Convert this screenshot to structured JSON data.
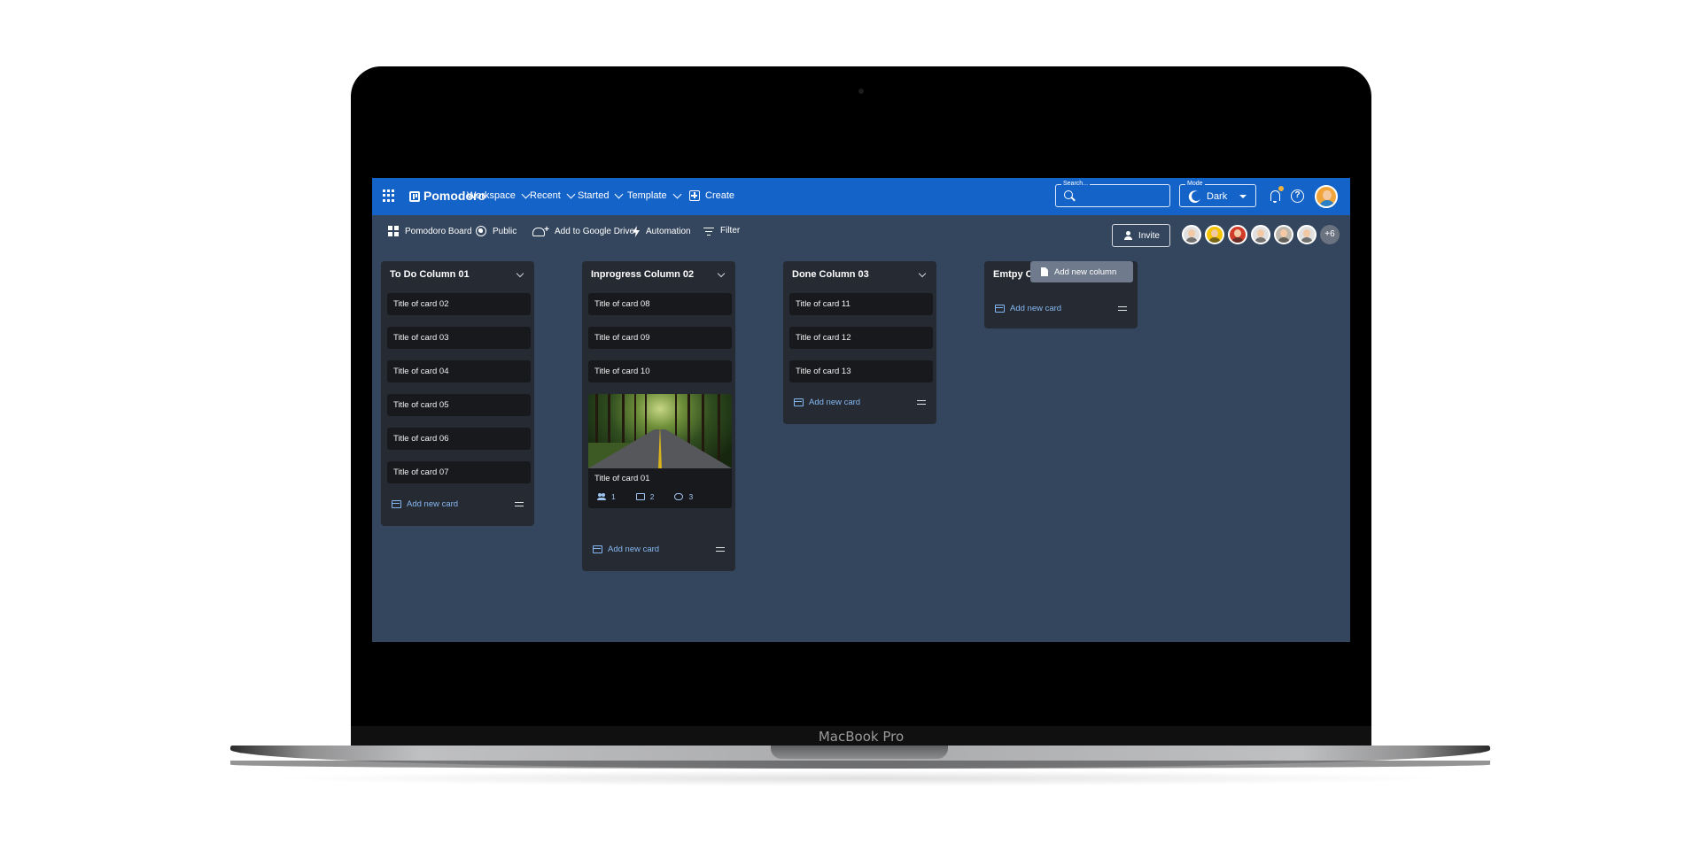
{
  "device": {
    "label": "MacBook Pro"
  },
  "appbar": {
    "brand": "Pomodoro",
    "nav": [
      {
        "label": "Workspace"
      },
      {
        "label": "Recent"
      },
      {
        "label": "Started"
      },
      {
        "label": "Template"
      }
    ],
    "create_label": "Create",
    "search": {
      "label": "Search...",
      "value": ""
    },
    "mode": {
      "label": "Mode",
      "value": "Dark"
    },
    "help_glyph": "?",
    "icons": [
      "apps-grid-icon",
      "board-logo-icon",
      "search-icon",
      "moon-icon",
      "bell-icon",
      "help-icon"
    ],
    "notification_dot_color": "#f3b33d",
    "bar_color": "#1463c9"
  },
  "toolbar": {
    "items": [
      {
        "label": "Pomodoro Board",
        "icon": "dashboard-icon"
      },
      {
        "label": "Public",
        "icon": "globe-icon"
      },
      {
        "label": "Add to Google Drive",
        "icon": "cloud-add-icon"
      },
      {
        "label": "Automation",
        "icon": "bolt-icon"
      },
      {
        "label": "Filter",
        "icon": "filter-icon"
      }
    ],
    "invite_label": "Invite",
    "team_more": "+6",
    "team_colors": [
      "#e0e0e0",
      "#f5c400",
      "#d23b2a",
      "#e0e0e0",
      "#bdb7ad",
      "#e0e0e0"
    ]
  },
  "board": {
    "background": "#34465e",
    "add_card_label": "Add new card",
    "add_column_label": "Add new column",
    "columns": [
      {
        "title": "To Do Column 01",
        "cards": [
          "Title of card 02",
          "Title of card 03",
          "Title of card 04",
          "Title of card 05",
          "Title of card 06",
          "Title of card 07"
        ]
      },
      {
        "title": "Inprogress Column 02",
        "cards": [
          "Title of card 08",
          "Title of card 09",
          "Title of card 10"
        ],
        "featured_card": {
          "title": "Title of card 01",
          "members": "1",
          "comments": "2",
          "attachments": "3"
        }
      },
      {
        "title": "Done Column 03",
        "cards": [
          "Title of card 11",
          "Title of card 12",
          "Title of card 13"
        ]
      },
      {
        "title": "Emtpy Column Column 03",
        "cards": []
      }
    ]
  }
}
